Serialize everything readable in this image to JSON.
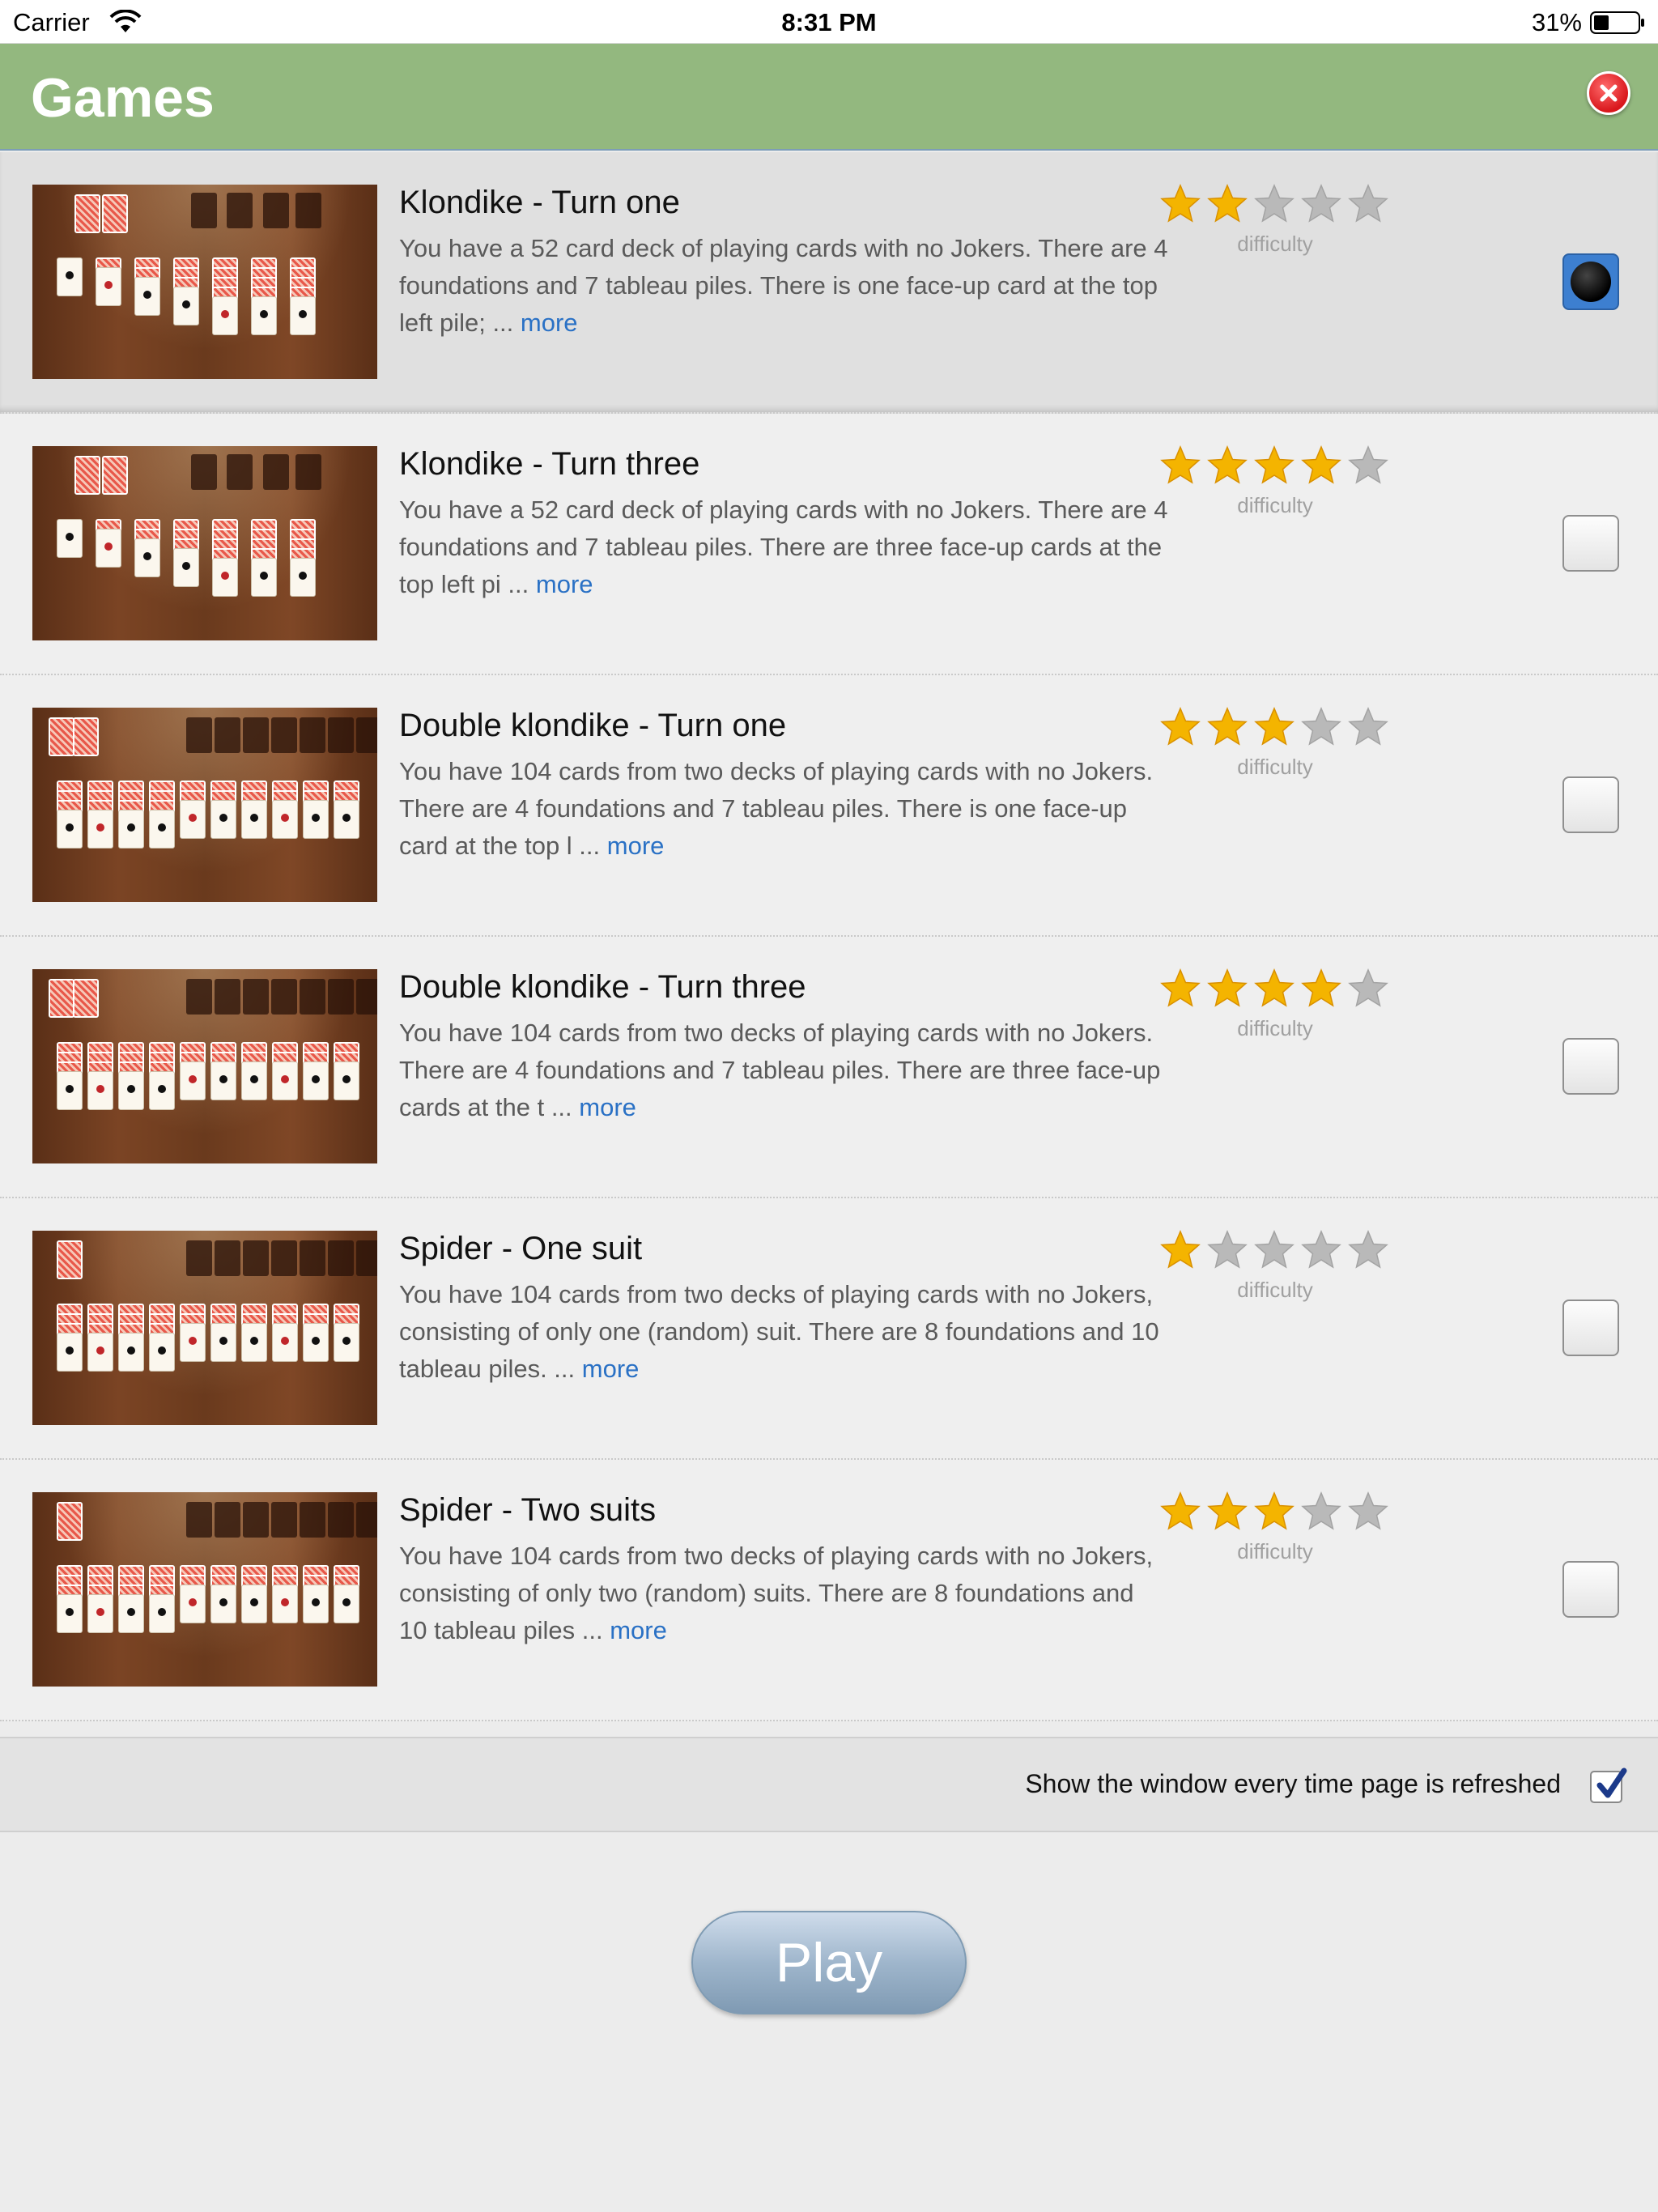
{
  "status_bar": {
    "carrier": "Carrier",
    "time": "8:31 PM",
    "battery": "31%"
  },
  "header": {
    "title": "Games",
    "close_icon": "close-icon"
  },
  "colors": {
    "header_bg": "#93b87f",
    "link": "#2a71c5",
    "star_on": "#f4b400",
    "star_off": "#b9b9b9"
  },
  "games": [
    {
      "title": "Klondike - Turn one",
      "description": "You have a 52 card deck of playing cards with no Jokers. There are 4 foundations and 7 tableau piles. There is one face-up card at the top left pile; ... ",
      "more": "more",
      "difficulty_label": "difficulty",
      "difficulty": 2,
      "selected": true
    },
    {
      "title": "Klondike - Turn three",
      "description": "You have a 52 card deck of playing cards with no Jokers. There are 4 foundations and 7 tableau piles. There are three face-up cards at the top left pi ... ",
      "more": "more",
      "difficulty_label": "difficulty",
      "difficulty": 4,
      "selected": false
    },
    {
      "title": "Double klondike - Turn one",
      "description": "You have 104 cards from two decks of playing cards with no Jokers. There are 4 foundations and 7 tableau piles. There is one face-up card at the top l ... ",
      "more": "more",
      "difficulty_label": "difficulty",
      "difficulty": 3,
      "selected": false
    },
    {
      "title": "Double klondike - Turn three",
      "description": "You have 104 cards from two decks of playing cards with no Jokers. There are 4 foundations and 7 tableau piles. There are three face-up cards at the t ... ",
      "more": "more",
      "difficulty_label": "difficulty",
      "difficulty": 4,
      "selected": false
    },
    {
      "title": "Spider - One suit",
      "description": "You have 104 cards from two decks of playing cards with no Jokers, consisting of only one (random) suit. There are 8 foundations and 10 tableau piles. ... ",
      "more": "more",
      "difficulty_label": "difficulty",
      "difficulty": 1,
      "selected": false
    },
    {
      "title": "Spider - Two suits",
      "description": "You have 104 cards from two decks of playing cards with no Jokers, consisting of only two (random) suits. There are 8 foundations and 10 tableau piles ... ",
      "more": "more",
      "difficulty_label": "difficulty",
      "difficulty": 3,
      "selected": false
    }
  ],
  "footer": {
    "show_window_label": "Show the window every time page is refreshed",
    "show_window_checked": true,
    "play_label": "Play"
  }
}
